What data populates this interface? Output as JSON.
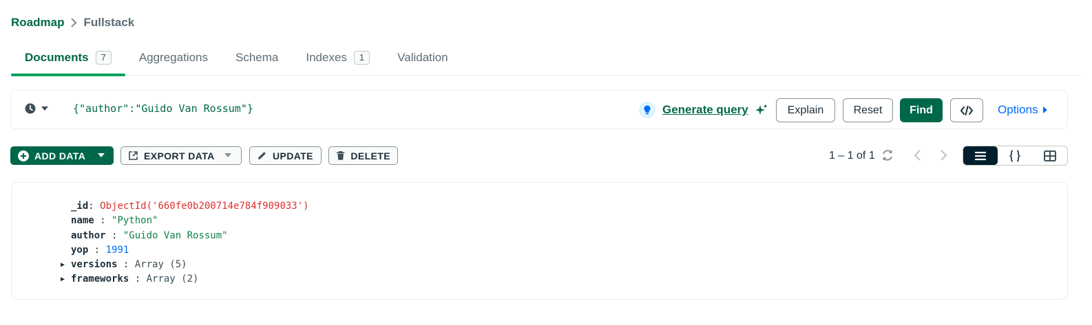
{
  "breadcrumb": {
    "root": "Roadmap",
    "current": "Fullstack"
  },
  "tabs": [
    {
      "label": "Documents",
      "count": "7"
    },
    {
      "label": "Aggregations"
    },
    {
      "label": "Schema"
    },
    {
      "label": "Indexes",
      "count": "1"
    },
    {
      "label": "Validation"
    }
  ],
  "query": {
    "open": "{",
    "key": "\"author\"",
    "colon": ":",
    "value": "\"Guido Van Rossum\"",
    "close": "}",
    "generate_label": "Generate query",
    "explain_label": "Explain",
    "reset_label": "Reset",
    "find_label": "Find",
    "options_label": "Options"
  },
  "toolbar": {
    "add_data": "ADD DATA",
    "export_data": "EXPORT DATA",
    "update": "UPDATE",
    "delete": "DELETE",
    "pager": "1 – 1 of 1"
  },
  "document": {
    "id_key": "_id",
    "id_value": "ObjectId('660fe0b200714e784f909033')",
    "name_key": "name",
    "name_value": "\"Python\"",
    "author_key": "author",
    "author_value": "\"Guido Van Rossum\"",
    "yop_key": "yop",
    "yop_value": "1991",
    "versions_key": "versions",
    "versions_value": "Array (5)",
    "frameworks_key": "frameworks",
    "frameworks_value": "Array (2)"
  },
  "colors": {
    "brand_green": "#00684a",
    "tab_indicator": "#00a35c",
    "link_blue": "#016bf8",
    "objectid_red": "#db3030"
  },
  "icons": [
    "clock-icon",
    "caret-down-icon",
    "lightbulb-icon",
    "sparkle-icon",
    "code-icon",
    "plus-circle-icon",
    "export-icon",
    "pencil-icon",
    "trash-icon",
    "refresh-icon",
    "chevron-left-icon",
    "chevron-right-icon",
    "list-view-icon",
    "json-view-icon",
    "table-view-icon"
  ]
}
